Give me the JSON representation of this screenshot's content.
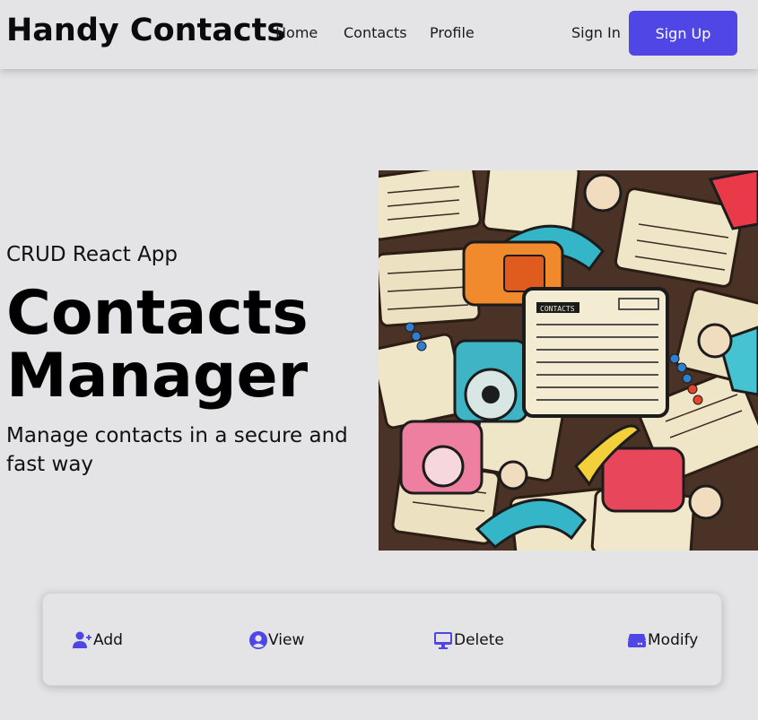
{
  "nav": {
    "brand": "Handy Contacts",
    "links": [
      "Home",
      "Contacts",
      "Profile"
    ],
    "sign_in": "Sign In",
    "sign_up": "Sign Up"
  },
  "hero": {
    "subtitle": "CRUD React App",
    "title": "Contacts Manager",
    "description": "Manage contacts in a secure and fast way",
    "image_alt": "Illustration of contact cards and retro telephones"
  },
  "features": [
    {
      "label": "Add",
      "icon": "user-plus-icon"
    },
    {
      "label": "View",
      "icon": "user-circle-icon"
    },
    {
      "label": "Delete",
      "icon": "monitor-icon"
    },
    {
      "label": "Modify",
      "icon": "hard-drive-icon"
    }
  ],
  "colors": {
    "accent": "#4f46e5",
    "background": "#e4e4e7"
  }
}
